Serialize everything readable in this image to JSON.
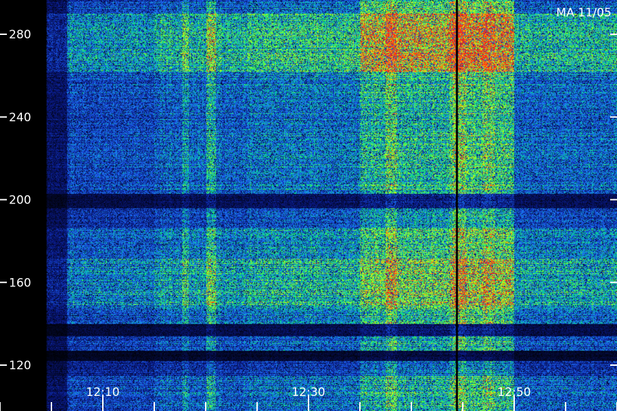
{
  "chart_data": {
    "type": "heatmap",
    "title": "MA 11/05",
    "xlabel": "",
    "ylabel": "",
    "grid": false,
    "x_axis": {
      "unit": "time",
      "range": [
        "12:00",
        "13:00"
      ],
      "tick_labels": [
        "12:10",
        "12:30",
        "12:50"
      ],
      "major_ticks": [
        "12:10",
        "12:30",
        "12:50"
      ],
      "minor_tick_step_min": 5
    },
    "y_axis": {
      "range": [
        115,
        290
      ],
      "tick_labels": [
        "120",
        "160",
        "200",
        "240",
        "280"
      ],
      "tick_values": [
        120,
        160,
        200,
        240,
        280
      ]
    },
    "colormap": [
      "#000000",
      "#0a1a8c",
      "#1f6fff",
      "#00e08a",
      "#7dff2a",
      "#e8ff18",
      "#ff3010"
    ],
    "intensity_profile": {
      "description_units": "relative intensity 0-1",
      "time_segments": [
        {
          "start": "12:00",
          "end": "12:04.5",
          "level": 0.0
        },
        {
          "start": "12:04.5",
          "end": "12:06.5",
          "level": 0.18
        },
        {
          "start": "12:06.5",
          "end": "12:15",
          "level": 0.38
        },
        {
          "start": "12:15",
          "end": "12:24",
          "level": 0.45
        },
        {
          "start": "12:24",
          "end": "12:35",
          "level": 0.5
        },
        {
          "start": "12:35",
          "end": "12:44",
          "level": 0.68
        },
        {
          "start": "12:44",
          "end": "12:50",
          "level": 0.78
        },
        {
          "start": "12:50",
          "end": "13:00",
          "level": 0.45
        }
      ],
      "bright_columns": [
        {
          "time": "12:18",
          "width_min": 0.6,
          "boost": 0.12
        },
        {
          "time": "12:20.5",
          "width_min": 1.0,
          "boost": 0.22
        },
        {
          "time": "12:38",
          "width_min": 1.2,
          "boost": 0.18
        },
        {
          "time": "12:44.5",
          "width_min": 1.6,
          "boost": 0.15
        },
        {
          "time": "12:47.5",
          "width_min": 1.2,
          "boost": 0.12
        }
      ],
      "dark_columns": [
        {
          "time": "12:44.4",
          "width_min": 0.25
        }
      ],
      "frequency_bands": [
        {
          "from": 115,
          "to": 122,
          "gain": 0.55
        },
        {
          "from": 122,
          "to": 127,
          "gain": 0.15
        },
        {
          "from": 127,
          "to": 134,
          "gain": 0.75
        },
        {
          "from": 134,
          "to": 140,
          "gain": 0.25
        },
        {
          "from": 140,
          "to": 148,
          "gain": 0.85
        },
        {
          "from": 148,
          "to": 172,
          "gain": 1.15
        },
        {
          "from": 172,
          "to": 186,
          "gain": 0.95
        },
        {
          "from": 186,
          "to": 196,
          "gain": 0.7
        },
        {
          "from": 196,
          "to": 203,
          "gain": 0.3
        },
        {
          "from": 203,
          "to": 262,
          "gain": 0.85
        },
        {
          "from": 262,
          "to": 290,
          "gain": 1.25
        }
      ]
    }
  }
}
